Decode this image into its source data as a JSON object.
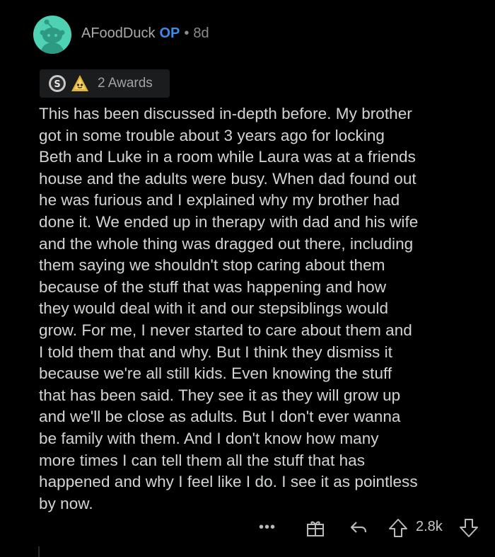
{
  "comment": {
    "author": "AFoodDuck",
    "op_label": "OP",
    "separator": "•",
    "age": "8d",
    "awards_label": "2 Awards",
    "body": "This has been discussed in-depth before. My brother\ngot in some trouble about 3  years ago for locking\nBeth and Luke in a room while Laura was at a friends\nhouse and the adults were busy. When dad found out\nhe was furious and I explained why my brother had\ndone it. We ended up in therapy with dad and his wife\nand the whole thing was dragged out there, including\nthem saying we shouldn't stop caring about them\nbecause of the stuff that was happening and how\nthey would deal with it and our stepsiblings would\ngrow. For me, I never started to care about them and\nI told them that and why. But I think they dismiss it\nbecause we're all still kids. Even knowing the stuff\nthat has been said. They see it as they will grow up\nand we'll be close as adults. But I don't ever wanna\nbe family with them. And I don't know how many\nmore times I can tell them all the stuff that has\nhappened and why I feel like I do. I see it as pointless\nby now.",
    "score": "2.8k",
    "more_label": "•••"
  },
  "icons": {
    "avatar": "reddit-snoo-avatar",
    "award_1": "silver-award-icon",
    "award_2": "helpful-award-icon",
    "gift": "gift-icon",
    "reply": "reply-icon",
    "upvote": "upvote-icon",
    "downvote": "downvote-icon"
  },
  "colors": {
    "background": "#000000",
    "op": "#3c8ce7",
    "avatar_bg": "#4fd1b4",
    "text": "#d2d4d6",
    "muted": "#8a8c8e"
  }
}
